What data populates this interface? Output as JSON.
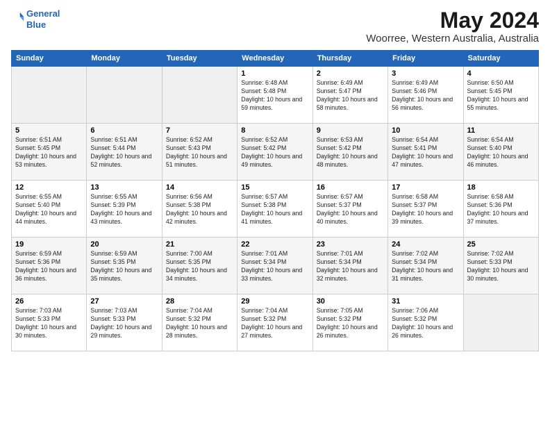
{
  "logo": {
    "line1": "General",
    "line2": "Blue"
  },
  "title": "May 2024",
  "location": "Woorree, Western Australia, Australia",
  "weekdays": [
    "Sunday",
    "Monday",
    "Tuesday",
    "Wednesday",
    "Thursday",
    "Friday",
    "Saturday"
  ],
  "weeks": [
    [
      {
        "day": "",
        "sunrise": "",
        "sunset": "",
        "daylight": ""
      },
      {
        "day": "",
        "sunrise": "",
        "sunset": "",
        "daylight": ""
      },
      {
        "day": "",
        "sunrise": "",
        "sunset": "",
        "daylight": ""
      },
      {
        "day": "1",
        "sunrise": "Sunrise: 6:48 AM",
        "sunset": "Sunset: 5:48 PM",
        "daylight": "Daylight: 10 hours and 59 minutes."
      },
      {
        "day": "2",
        "sunrise": "Sunrise: 6:49 AM",
        "sunset": "Sunset: 5:47 PM",
        "daylight": "Daylight: 10 hours and 58 minutes."
      },
      {
        "day": "3",
        "sunrise": "Sunrise: 6:49 AM",
        "sunset": "Sunset: 5:46 PM",
        "daylight": "Daylight: 10 hours and 56 minutes."
      },
      {
        "day": "4",
        "sunrise": "Sunrise: 6:50 AM",
        "sunset": "Sunset: 5:45 PM",
        "daylight": "Daylight: 10 hours and 55 minutes."
      }
    ],
    [
      {
        "day": "5",
        "sunrise": "Sunrise: 6:51 AM",
        "sunset": "Sunset: 5:45 PM",
        "daylight": "Daylight: 10 hours and 53 minutes."
      },
      {
        "day": "6",
        "sunrise": "Sunrise: 6:51 AM",
        "sunset": "Sunset: 5:44 PM",
        "daylight": "Daylight: 10 hours and 52 minutes."
      },
      {
        "day": "7",
        "sunrise": "Sunrise: 6:52 AM",
        "sunset": "Sunset: 5:43 PM",
        "daylight": "Daylight: 10 hours and 51 minutes."
      },
      {
        "day": "8",
        "sunrise": "Sunrise: 6:52 AM",
        "sunset": "Sunset: 5:42 PM",
        "daylight": "Daylight: 10 hours and 49 minutes."
      },
      {
        "day": "9",
        "sunrise": "Sunrise: 6:53 AM",
        "sunset": "Sunset: 5:42 PM",
        "daylight": "Daylight: 10 hours and 48 minutes."
      },
      {
        "day": "10",
        "sunrise": "Sunrise: 6:54 AM",
        "sunset": "Sunset: 5:41 PM",
        "daylight": "Daylight: 10 hours and 47 minutes."
      },
      {
        "day": "11",
        "sunrise": "Sunrise: 6:54 AM",
        "sunset": "Sunset: 5:40 PM",
        "daylight": "Daylight: 10 hours and 46 minutes."
      }
    ],
    [
      {
        "day": "12",
        "sunrise": "Sunrise: 6:55 AM",
        "sunset": "Sunset: 5:40 PM",
        "daylight": "Daylight: 10 hours and 44 minutes."
      },
      {
        "day": "13",
        "sunrise": "Sunrise: 6:55 AM",
        "sunset": "Sunset: 5:39 PM",
        "daylight": "Daylight: 10 hours and 43 minutes."
      },
      {
        "day": "14",
        "sunrise": "Sunrise: 6:56 AM",
        "sunset": "Sunset: 5:38 PM",
        "daylight": "Daylight: 10 hours and 42 minutes."
      },
      {
        "day": "15",
        "sunrise": "Sunrise: 6:57 AM",
        "sunset": "Sunset: 5:38 PM",
        "daylight": "Daylight: 10 hours and 41 minutes."
      },
      {
        "day": "16",
        "sunrise": "Sunrise: 6:57 AM",
        "sunset": "Sunset: 5:37 PM",
        "daylight": "Daylight: 10 hours and 40 minutes."
      },
      {
        "day": "17",
        "sunrise": "Sunrise: 6:58 AM",
        "sunset": "Sunset: 5:37 PM",
        "daylight": "Daylight: 10 hours and 39 minutes."
      },
      {
        "day": "18",
        "sunrise": "Sunrise: 6:58 AM",
        "sunset": "Sunset: 5:36 PM",
        "daylight": "Daylight: 10 hours and 37 minutes."
      }
    ],
    [
      {
        "day": "19",
        "sunrise": "Sunrise: 6:59 AM",
        "sunset": "Sunset: 5:36 PM",
        "daylight": "Daylight: 10 hours and 36 minutes."
      },
      {
        "day": "20",
        "sunrise": "Sunrise: 6:59 AM",
        "sunset": "Sunset: 5:35 PM",
        "daylight": "Daylight: 10 hours and 35 minutes."
      },
      {
        "day": "21",
        "sunrise": "Sunrise: 7:00 AM",
        "sunset": "Sunset: 5:35 PM",
        "daylight": "Daylight: 10 hours and 34 minutes."
      },
      {
        "day": "22",
        "sunrise": "Sunrise: 7:01 AM",
        "sunset": "Sunset: 5:34 PM",
        "daylight": "Daylight: 10 hours and 33 minutes."
      },
      {
        "day": "23",
        "sunrise": "Sunrise: 7:01 AM",
        "sunset": "Sunset: 5:34 PM",
        "daylight": "Daylight: 10 hours and 32 minutes."
      },
      {
        "day": "24",
        "sunrise": "Sunrise: 7:02 AM",
        "sunset": "Sunset: 5:34 PM",
        "daylight": "Daylight: 10 hours and 31 minutes."
      },
      {
        "day": "25",
        "sunrise": "Sunrise: 7:02 AM",
        "sunset": "Sunset: 5:33 PM",
        "daylight": "Daylight: 10 hours and 30 minutes."
      }
    ],
    [
      {
        "day": "26",
        "sunrise": "Sunrise: 7:03 AM",
        "sunset": "Sunset: 5:33 PM",
        "daylight": "Daylight: 10 hours and 30 minutes."
      },
      {
        "day": "27",
        "sunrise": "Sunrise: 7:03 AM",
        "sunset": "Sunset: 5:33 PM",
        "daylight": "Daylight: 10 hours and 29 minutes."
      },
      {
        "day": "28",
        "sunrise": "Sunrise: 7:04 AM",
        "sunset": "Sunset: 5:32 PM",
        "daylight": "Daylight: 10 hours and 28 minutes."
      },
      {
        "day": "29",
        "sunrise": "Sunrise: 7:04 AM",
        "sunset": "Sunset: 5:32 PM",
        "daylight": "Daylight: 10 hours and 27 minutes."
      },
      {
        "day": "30",
        "sunrise": "Sunrise: 7:05 AM",
        "sunset": "Sunset: 5:32 PM",
        "daylight": "Daylight: 10 hours and 26 minutes."
      },
      {
        "day": "31",
        "sunrise": "Sunrise: 7:06 AM",
        "sunset": "Sunset: 5:32 PM",
        "daylight": "Daylight: 10 hours and 26 minutes."
      },
      {
        "day": "",
        "sunrise": "",
        "sunset": "",
        "daylight": ""
      }
    ]
  ]
}
